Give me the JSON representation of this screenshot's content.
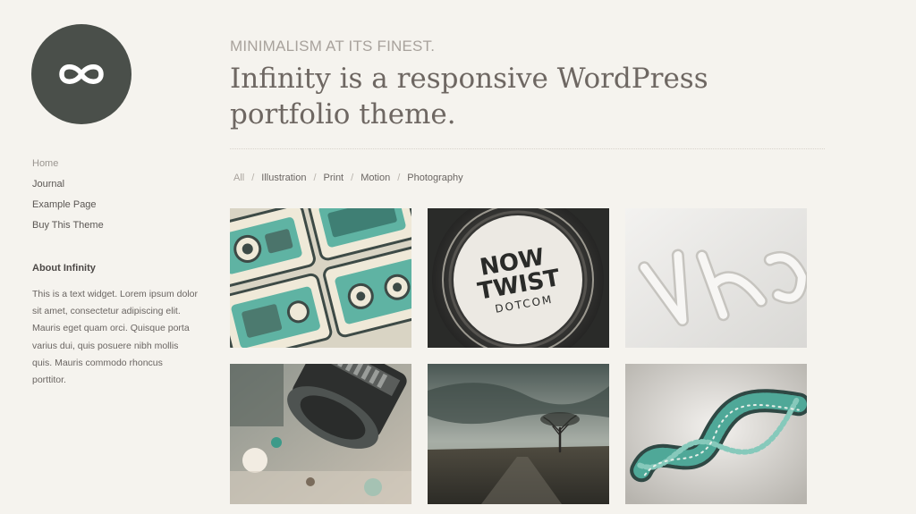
{
  "site": {
    "logo_icon": "infinity-icon",
    "logo_bg": "#4a4f4a"
  },
  "nav": {
    "items": [
      {
        "label": "Home",
        "active": true
      },
      {
        "label": "Journal"
      },
      {
        "label": "Example Page"
      },
      {
        "label": "Buy This Theme"
      }
    ]
  },
  "widget": {
    "title": "About Infinity",
    "text": "This is a text widget. Lorem ipsum dolor sit amet, consectetur adipiscing elit. Mauris eget quam orci. Quisque porta varius dui, quis posuere nibh mollis quis. Mauris commodo rhoncus porttitor."
  },
  "header": {
    "tagline": "MINIMALISM AT ITS FINEST.",
    "headline": "Infinity is a responsive WordPress portfolio theme."
  },
  "filters": {
    "items": [
      "All",
      "Illustration",
      "Print",
      "Motion",
      "Photography"
    ],
    "separator": "/"
  },
  "portfolio": {
    "items": [
      {
        "image": "teal-radio-illustration"
      },
      {
        "image": "now-twist-badge",
        "badge_lines": [
          "NOW",
          "TWIST",
          "DOTCOM"
        ]
      },
      {
        "image": "embossed-white-letters"
      },
      {
        "image": "camera-lens-closeup"
      },
      {
        "image": "lone-tree-landscape"
      },
      {
        "image": "teal-twisted-sculpture"
      }
    ]
  },
  "colors": {
    "background": "#f5f3ee",
    "accent_teal": "#4fa898",
    "text": "#5f5b58"
  }
}
